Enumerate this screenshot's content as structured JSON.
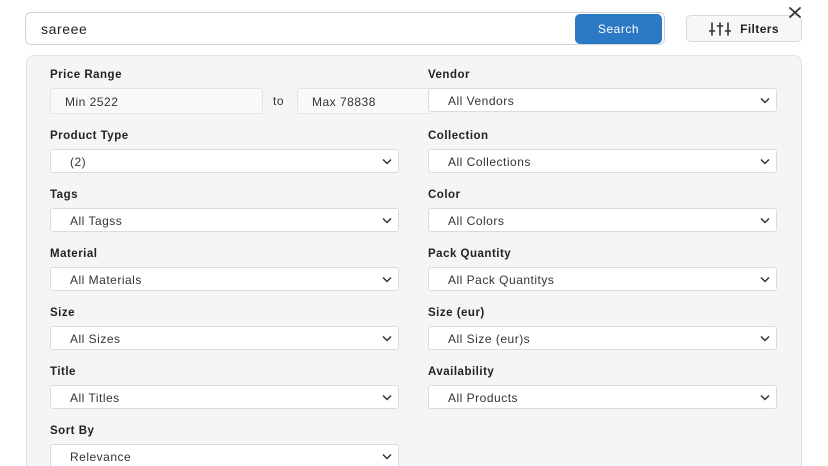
{
  "search": {
    "query": "sareee",
    "button_label": "Search"
  },
  "filters_button": {
    "label": "Filters",
    "icon": "sliders-icon"
  },
  "close": {
    "icon": "close-icon"
  },
  "colors": {
    "accent": "#2b78c5",
    "panel_bg": "#f4f5f6"
  },
  "price_range": {
    "label": "Price Range",
    "min": "Min 2522",
    "to": "to",
    "max": "Max 78838"
  },
  "vendor": {
    "label": "Vendor",
    "value": "All Vendors"
  },
  "product_type": {
    "label": "Product Type",
    "value": "(2)"
  },
  "collection": {
    "label": "Collection",
    "value": "All Collections"
  },
  "tags": {
    "label": "Tags",
    "value": "All Tagss"
  },
  "color": {
    "label": "Color",
    "value": "All Colors"
  },
  "material": {
    "label": "Material",
    "value": "All Materials"
  },
  "pack_quantity": {
    "label": "Pack Quantity",
    "value": "All Pack Quantitys"
  },
  "size": {
    "label": "Size",
    "value": "All Sizes"
  },
  "size_eur": {
    "label": "Size (eur)",
    "value": "All Size (eur)s"
  },
  "title": {
    "label": "Title",
    "value": "All Titles"
  },
  "availability": {
    "label": "Availability",
    "value": "All Products"
  },
  "sort_by": {
    "label": "Sort By",
    "value": "Relevance"
  }
}
